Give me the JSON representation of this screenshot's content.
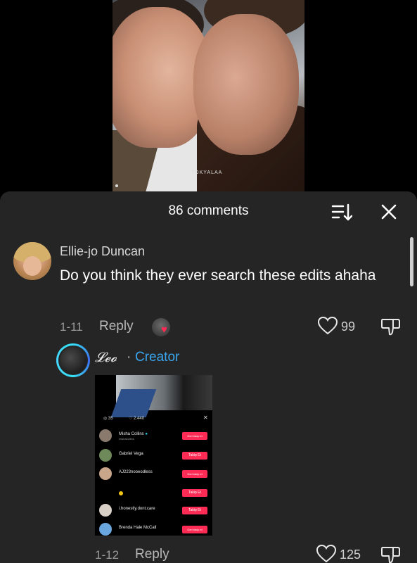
{
  "comments_header": {
    "count_label": "86 comments"
  },
  "comment": {
    "username": "Ellie-jo Duncan",
    "text": "Do you think they ever search these edits ahaha",
    "date": "1-11",
    "reply_label": "Reply",
    "like_count": "99"
  },
  "reply_comment": {
    "username": "𝓛𝓮𝓸",
    "separator": "·",
    "creator_label": "Creator",
    "date": "1-12",
    "reply_label": "Reply",
    "like_count": "125",
    "embedded_screenshot": {
      "comment_count": "35",
      "like_count": "2.440",
      "users": [
        {
          "name": "Misha Collins",
          "handle": "mishacollins",
          "button": "Geri takip et"
        },
        {
          "name": "Gabriel Vega",
          "handle": "",
          "button": "Takip Et"
        },
        {
          "name": "AJ223nooeodless",
          "handle": "",
          "button": "Geri takip et"
        },
        {
          "name": "",
          "handle": "",
          "button": "Takip Et"
        },
        {
          "name": "i.honestly.dont.care",
          "handle": "",
          "button": "Takip Et"
        },
        {
          "name": "Brenda Hale McCall",
          "handle": "",
          "button": "Geri takip et"
        }
      ]
    }
  },
  "video": {
    "watermark": "TOKYALAA"
  },
  "colors": {
    "sheet_bg": "#252525",
    "accent_red": "#fe2c55",
    "creator_blue": "#3aa6f0"
  },
  "icons": [
    "sort-icon",
    "close-icon",
    "heart-icon",
    "dislike-icon",
    "verified-icon",
    "close-icon-small"
  ]
}
